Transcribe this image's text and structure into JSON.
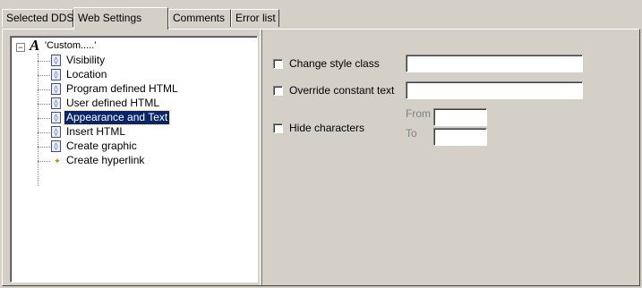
{
  "tabs": [
    {
      "label": "Selected DDS",
      "active": false
    },
    {
      "label": "Web Settings",
      "active": true
    },
    {
      "label": "Comments",
      "active": false
    },
    {
      "label": "Error list",
      "active": false
    }
  ],
  "tree": {
    "root": {
      "label": "'Custom.....'",
      "expander": "−",
      "icon": "A"
    },
    "items": [
      {
        "label": "Visibility",
        "icon": "html-tag-icon"
      },
      {
        "label": "Location",
        "icon": "html-tag-icon"
      },
      {
        "label": "Program defined HTML",
        "icon": "html-tag-icon"
      },
      {
        "label": "User defined HTML",
        "icon": "html-tag-icon"
      },
      {
        "label": "Appearance and Text",
        "icon": "html-tag-icon",
        "selected": true
      },
      {
        "label": "Insert HTML",
        "icon": "html-tag-icon"
      },
      {
        "label": "Create graphic",
        "icon": "html-tag-icon"
      },
      {
        "label": "Create hyperlink",
        "icon": "hyperlink-icon"
      }
    ]
  },
  "form": {
    "change_style_class": {
      "label": "Change style class",
      "checked": false,
      "value": ""
    },
    "override_constant_text": {
      "label": "Override constant text",
      "checked": false,
      "value": ""
    },
    "hide_characters": {
      "label": "Hide characters",
      "checked": false,
      "from_label": "From",
      "to_label": "To",
      "from_value": "",
      "to_value": ""
    }
  }
}
